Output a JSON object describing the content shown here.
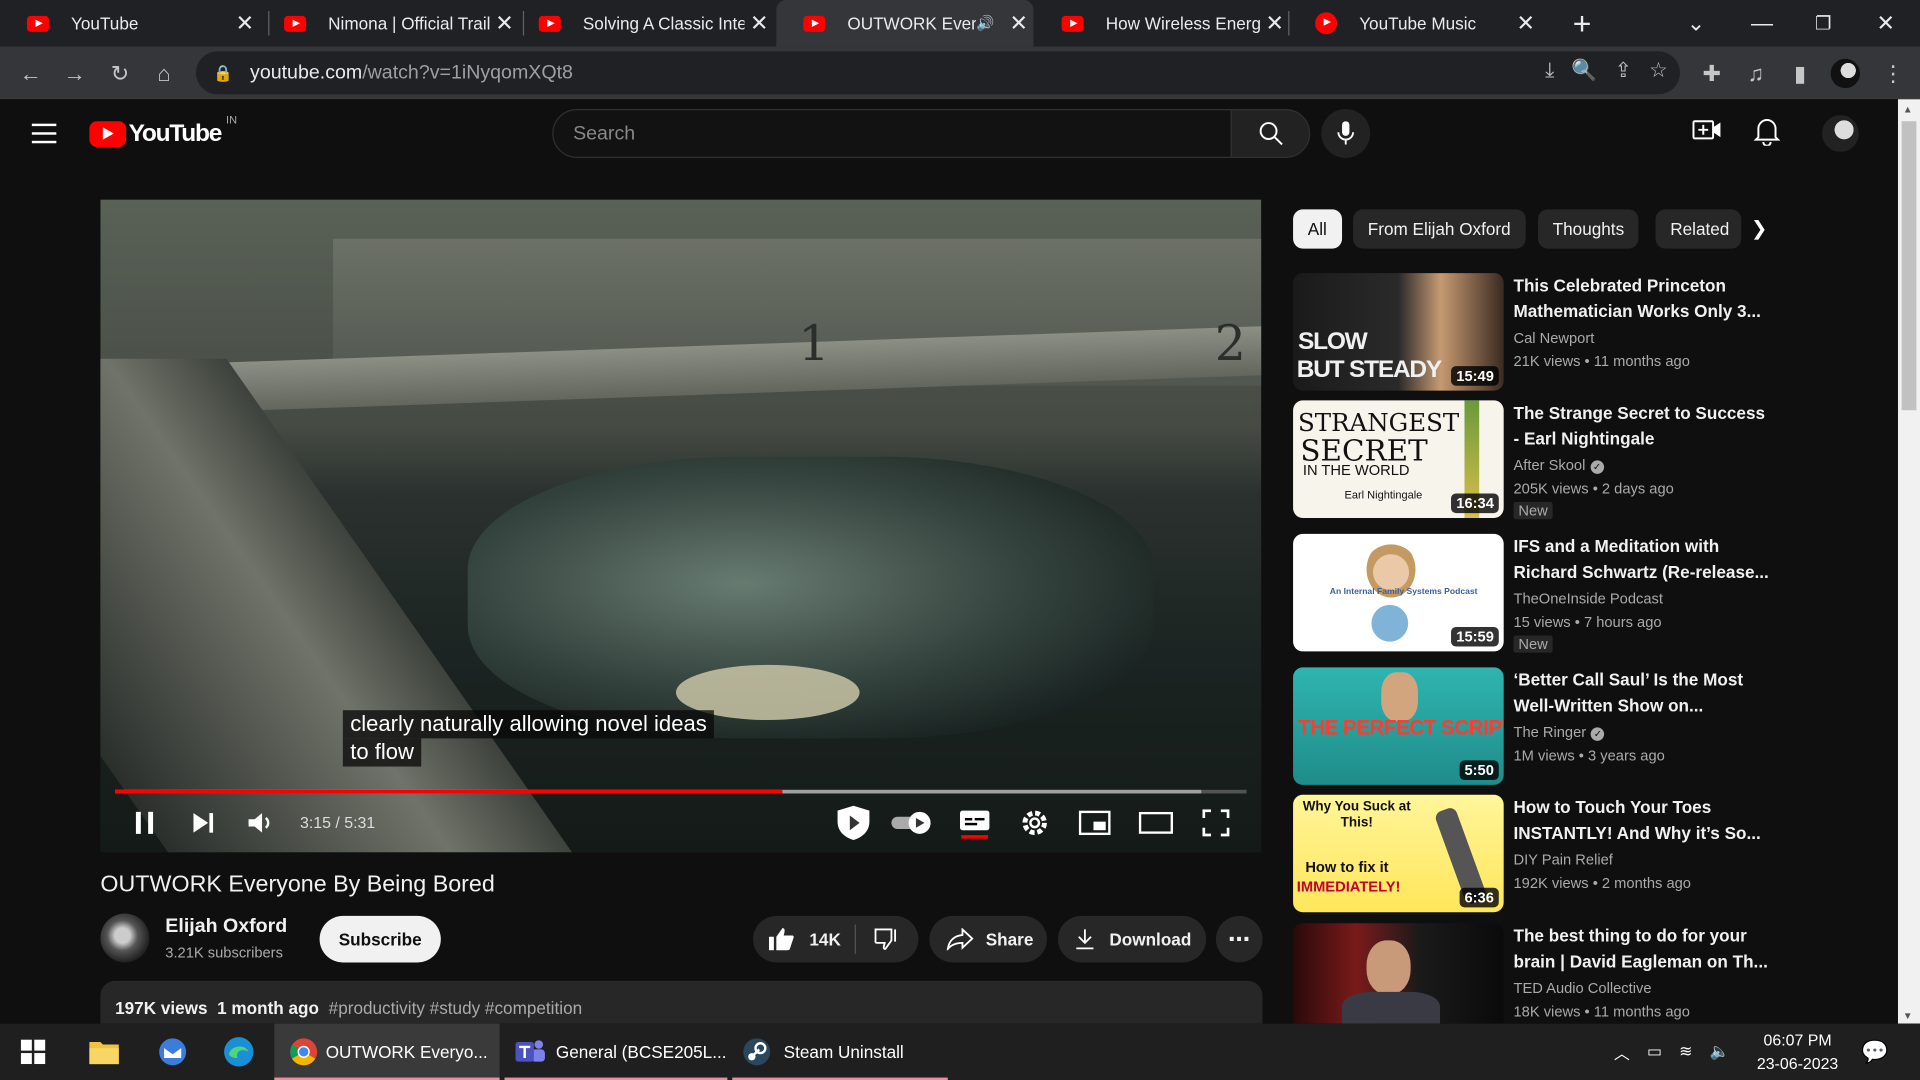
{
  "browser": {
    "tabs": [
      {
        "title": "YouTube",
        "type": "youtube"
      },
      {
        "title": "Nimona | Official Traile",
        "type": "youtube"
      },
      {
        "title": "Solving A Classic Inter",
        "type": "youtube"
      },
      {
        "title": "OUTWORK Everyo",
        "type": "youtube",
        "active": true,
        "audio": true
      },
      {
        "title": "How Wireless Energy F",
        "type": "youtube"
      },
      {
        "title": "YouTube Music",
        "type": "music"
      }
    ],
    "url_host": "youtube.com",
    "url_path": "/watch?v=1iNyqomXQt8"
  },
  "header": {
    "logo": "YouTube",
    "country": "IN",
    "search_placeholder": "Search"
  },
  "video": {
    "caption_line1": "clearly naturally allowing novel ideas",
    "caption_line2": "to flow",
    "time": "3:15 / 5:31",
    "played_fraction": 0.59,
    "loaded_fraction": 0.96,
    "pool_lane_1": "1",
    "pool_lane_2": "2"
  },
  "meta": {
    "title": "OUTWORK Everyone By Being Bored",
    "channel": "Elijah Oxford",
    "subscribers": "3.21K subscribers",
    "subscribe_label": "Subscribe",
    "likes": "14K",
    "share_label": "Share",
    "download_label": "Download",
    "views": "197K views",
    "age": "1 month ago",
    "tags": "#productivity #study #competition"
  },
  "chips": [
    "All",
    "From Elijah Oxford",
    "Thoughts",
    "Related"
  ],
  "recommendations": [
    {
      "title1": "This Celebrated Princeton",
      "title2": "Mathematician Works Only 3...",
      "channel": "Cal Newport",
      "verified": false,
      "meta": "21K views  • 11 months ago",
      "duration": "15:49",
      "new": false,
      "thumb_text1": "SLOW",
      "thumb_text2": "BUT STEADY"
    },
    {
      "title1": "The Strange Secret to Success",
      "title2": "- Earl Nightingale",
      "channel": "After Skool",
      "verified": true,
      "meta": "205K views  • 2 days ago",
      "duration": "16:34",
      "new": true,
      "new_label": "New",
      "thumb_text1": "STRANGEST",
      "thumb_text2": "SECRET",
      "thumb_text3": "IN THE WORLD",
      "thumb_text4": "Earl Nightingale"
    },
    {
      "title1": "IFS and a Meditation with",
      "title2": "Richard Schwartz (Re-release...",
      "channel": "TheOneInside Podcast",
      "verified": false,
      "meta": "15 views  • 7 hours ago",
      "duration": "15:59",
      "new": true,
      "new_label": "New",
      "thumb_text1": "An Internal Family Systems Podcast"
    },
    {
      "title1": "‘Better Call Saul’ Is the Most",
      "title2": "Well-Written Show on...",
      "channel": "The Ringer",
      "verified": true,
      "meta": "1M views  • 3 years ago",
      "duration": "5:50",
      "new": false,
      "thumb_text1": "THE PERFECT SCRIPT"
    },
    {
      "title1": "How to Touch Your Toes",
      "title2": "INSTANTLY! And Why it’s So...",
      "channel": "DIY Pain Relief",
      "verified": false,
      "meta": "192K views  • 2 months ago",
      "duration": "6:36",
      "new": false,
      "thumb_text1": "Why You Suck at This!",
      "thumb_text2": "How to fix it",
      "thumb_text3": "IMMEDIATELY!"
    },
    {
      "title1": "The best thing to do for your",
      "title2": "brain | David Eagleman on Th...",
      "channel": "TED Audio Collective",
      "verified": false,
      "meta": "18K views  • 11 months ago",
      "duration": "",
      "new": false
    }
  ],
  "taskbar": {
    "apps": [
      {
        "label": "OUTWORK Everyo...",
        "icon": "chrome-icon"
      },
      {
        "label": "General (BCSE205L...",
        "icon": "teams-icon"
      },
      {
        "label": "Steam Uninstall",
        "icon": "steam-icon"
      }
    ],
    "time": "06:07 PM",
    "date": "23-06-2023"
  },
  "colors": {
    "yt_red": "#ff0000",
    "bg": "#0f0f0f",
    "chip": "#272727"
  }
}
